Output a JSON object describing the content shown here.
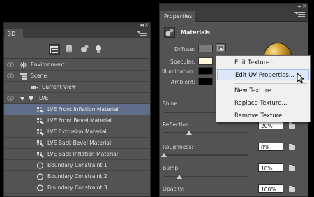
{
  "panel_3d": {
    "title": "3D",
    "rows": [
      {
        "label": "Environment"
      },
      {
        "label": "Scene"
      },
      {
        "label": "Current View"
      },
      {
        "label": "LVE"
      },
      {
        "label": "LVE Front Inflation Material"
      },
      {
        "label": "LVE Front Bevel Material"
      },
      {
        "label": "LVE Extrusion Material"
      },
      {
        "label": "LVE Back Bevel Material"
      },
      {
        "label": "LVE Back Inflation Material"
      },
      {
        "label": "Boundary Constraint 1"
      },
      {
        "label": "Boundary Constraint 2"
      },
      {
        "label": "Boundary Constraint 3"
      }
    ]
  },
  "properties": {
    "title": "Properties",
    "section": "Materials",
    "labels": {
      "diffuse": "Diffuse:",
      "specular": "Specular:",
      "illumination": "Illumination:",
      "ambient": "Ambient:",
      "shine": "Shine:",
      "reflection": "Reflection:",
      "roughness": "Roughness:",
      "bump": "Bump:",
      "opacity": "Opacity:"
    },
    "values": {
      "reflection": "20%",
      "roughness": "0%",
      "bump": "10%",
      "opacity": "100%"
    },
    "colors": {
      "diffuse": "#7a7a7a",
      "specular": "#fff6dc",
      "illumination": "#000000",
      "ambient": "#000000"
    }
  },
  "context_menu": {
    "items": [
      {
        "label": "Edit Texture..."
      },
      {
        "label": "Edit UV Properties..."
      },
      {
        "label": "New Texture..."
      },
      {
        "label": "Replace Texture..."
      },
      {
        "label": "Remove Texture"
      }
    ]
  },
  "theme": {
    "selection": "#5f6d88",
    "menu_hover": "#dce8f8"
  }
}
